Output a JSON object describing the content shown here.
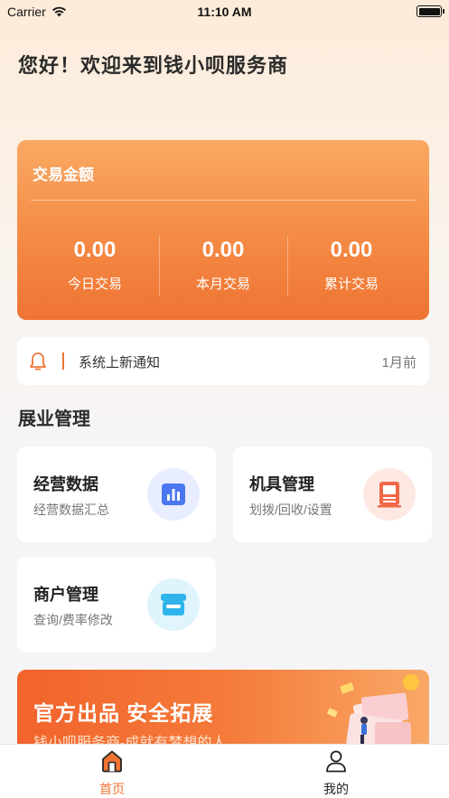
{
  "status_bar": {
    "carrier": "Carrier",
    "time": "11:10 AM"
  },
  "greeting": "您好！欢迎来到钱小呗服务商",
  "stats_card": {
    "title": "交易金额",
    "items": [
      {
        "value": "0.00",
        "label": "今日交易"
      },
      {
        "value": "0.00",
        "label": "本月交易"
      },
      {
        "value": "0.00",
        "label": "累计交易"
      }
    ]
  },
  "notice": {
    "icon": "bell-icon",
    "text": "系统上新通知",
    "time": "1月前"
  },
  "section": {
    "title": "展业管理"
  },
  "tiles": [
    {
      "title": "经营数据",
      "subtitle": "经营数据汇总",
      "icon": "bar-chart-icon"
    },
    {
      "title": "机具管理",
      "subtitle": "划拨/回收/设置",
      "icon": "device-icon"
    },
    {
      "title": "商户管理",
      "subtitle": "查询/费率修改",
      "icon": "store-icon"
    }
  ],
  "banner": {
    "headline": "官方出品 安全拓展",
    "tagline": "钱小呗服务商-成就有梦想的人"
  },
  "tabbar": [
    {
      "label": "首页",
      "icon": "home-icon",
      "active": true
    },
    {
      "label": "我的",
      "icon": "user-icon",
      "active": false
    }
  ],
  "colors": {
    "accent": "#ef7433",
    "accent_light": "#f9a963"
  }
}
